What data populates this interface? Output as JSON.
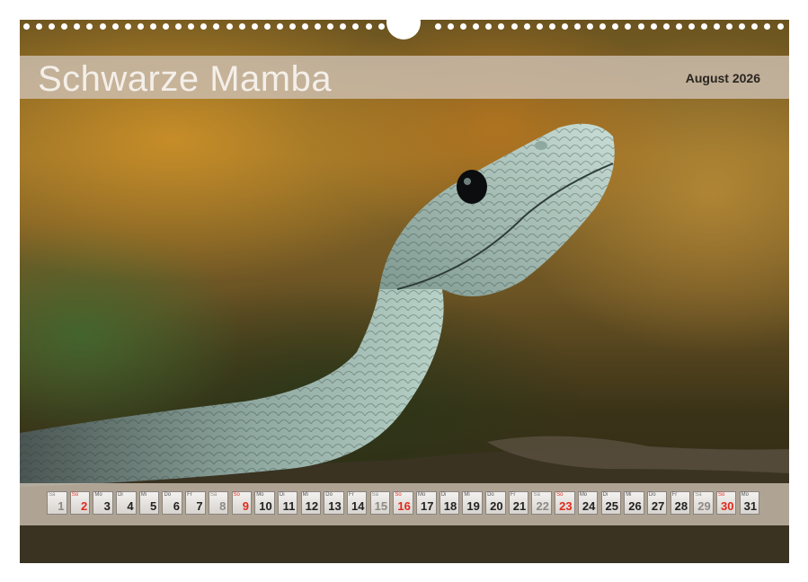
{
  "calendar": {
    "title": "Schwarze Mamba",
    "month_label": "August 2026",
    "days": [
      {
        "n": "Sa",
        "d": "1",
        "type": "sat"
      },
      {
        "n": "So",
        "d": "2",
        "type": "sun"
      },
      {
        "n": "Mo",
        "d": "3",
        "type": "week"
      },
      {
        "n": "Di",
        "d": "4",
        "type": "week"
      },
      {
        "n": "Mi",
        "d": "5",
        "type": "week"
      },
      {
        "n": "Do",
        "d": "6",
        "type": "week"
      },
      {
        "n": "Fr",
        "d": "7",
        "type": "week"
      },
      {
        "n": "Sa",
        "d": "8",
        "type": "sat"
      },
      {
        "n": "So",
        "d": "9",
        "type": "sun"
      },
      {
        "n": "Mo",
        "d": "10",
        "type": "week"
      },
      {
        "n": "Di",
        "d": "11",
        "type": "week"
      },
      {
        "n": "Mi",
        "d": "12",
        "type": "week"
      },
      {
        "n": "Do",
        "d": "13",
        "type": "week"
      },
      {
        "n": "Fr",
        "d": "14",
        "type": "week"
      },
      {
        "n": "Sa",
        "d": "15",
        "type": "sat"
      },
      {
        "n": "So",
        "d": "16",
        "type": "sun"
      },
      {
        "n": "Mo",
        "d": "17",
        "type": "week"
      },
      {
        "n": "Di",
        "d": "18",
        "type": "week"
      },
      {
        "n": "Mi",
        "d": "19",
        "type": "week"
      },
      {
        "n": "Do",
        "d": "20",
        "type": "week"
      },
      {
        "n": "Fr",
        "d": "21",
        "type": "week"
      },
      {
        "n": "Sa",
        "d": "22",
        "type": "sat"
      },
      {
        "n": "So",
        "d": "23",
        "type": "sun"
      },
      {
        "n": "Mo",
        "d": "24",
        "type": "week"
      },
      {
        "n": "Di",
        "d": "25",
        "type": "week"
      },
      {
        "n": "Mi",
        "d": "26",
        "type": "week"
      },
      {
        "n": "Do",
        "d": "27",
        "type": "week"
      },
      {
        "n": "Fr",
        "d": "28",
        "type": "week"
      },
      {
        "n": "Sa",
        "d": "29",
        "type": "sat"
      },
      {
        "n": "So",
        "d": "30",
        "type": "sun"
      },
      {
        "n": "Mo",
        "d": "31",
        "type": "week"
      }
    ]
  },
  "colors": {
    "sunday": "#e02a1e",
    "saturday": "#8d8a86",
    "weekday": "#222222",
    "band": "#cdc0b2"
  }
}
